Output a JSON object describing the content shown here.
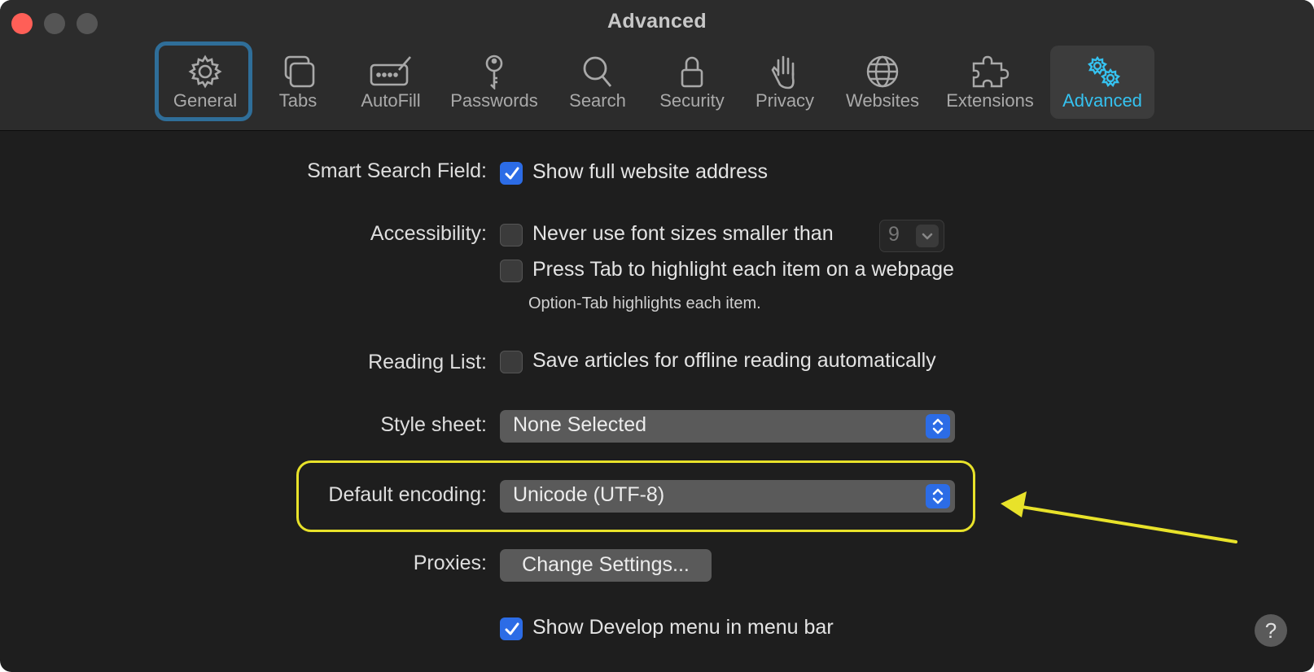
{
  "window": {
    "title": "Advanced"
  },
  "toolbar": {
    "tabs": [
      {
        "label": "General",
        "icon": "gear-icon"
      },
      {
        "label": "Tabs",
        "icon": "tabs-icon"
      },
      {
        "label": "AutoFill",
        "icon": "autofill-icon"
      },
      {
        "label": "Passwords",
        "icon": "key-icon"
      },
      {
        "label": "Search",
        "icon": "search-icon"
      },
      {
        "label": "Security",
        "icon": "lock-icon"
      },
      {
        "label": "Privacy",
        "icon": "hand-icon"
      },
      {
        "label": "Websites",
        "icon": "globe-icon"
      },
      {
        "label": "Extensions",
        "icon": "puzzle-icon"
      },
      {
        "label": "Advanced",
        "icon": "gears-icon"
      }
    ],
    "selected": "Advanced",
    "accent_color": "#35c2f0"
  },
  "settings": {
    "smart_search": {
      "label": "Smart Search Field:",
      "option": "Show full website address",
      "checked": true
    },
    "accessibility": {
      "label": "Accessibility:",
      "option1": "Never use font sizes smaller than",
      "option1_checked": false,
      "font_size": "9",
      "option2": "Press Tab to highlight each item on a webpage",
      "option2_checked": false,
      "note": "Option-Tab highlights each item."
    },
    "reading_list": {
      "label": "Reading List:",
      "option": "Save articles for offline reading automatically",
      "checked": false
    },
    "style_sheet": {
      "label": "Style sheet:",
      "value": "None Selected"
    },
    "default_encoding": {
      "label": "Default encoding:",
      "value": "Unicode (UTF-8)"
    },
    "proxies": {
      "label": "Proxies:",
      "button": "Change Settings..."
    },
    "develop_menu": {
      "option": "Show Develop menu in menu bar",
      "checked": true
    }
  },
  "help": {
    "label": "?"
  },
  "annotation_color": "#e8e22a"
}
